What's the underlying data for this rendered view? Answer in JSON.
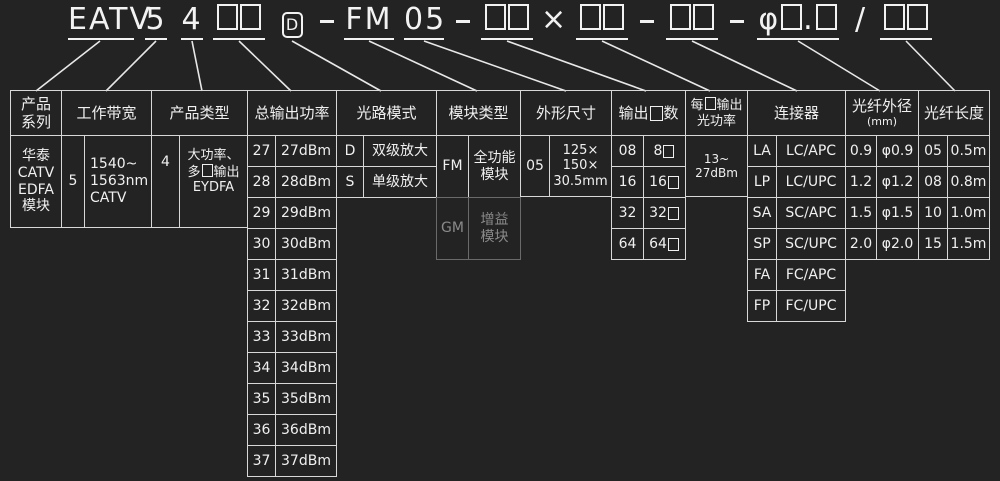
{
  "code": {
    "eatv": "EATV",
    "d5": "5",
    "d4": "4",
    "ptype": "D",
    "fm": "FM",
    "num05": "05",
    "times": "×",
    "phi": "φ",
    "dot": ".",
    "slash": "/"
  },
  "headers": {
    "series": "产品\n系列",
    "band": "工作带宽",
    "ptype": "产品类型",
    "power": "总输出功率",
    "route": "光路模式",
    "module": "模块类型",
    "size": "外形尺寸",
    "ports": "输出",
    "ports_suffix": "数",
    "perport": "每",
    "perport_suffix": "输出\n光功率",
    "connector": "连接器",
    "diameter": "光纤外径",
    "diameter_unit": "(mm)",
    "length": "光纤长度"
  },
  "series": {
    "text": "华泰\nCATV\nEDFA\n模块"
  },
  "band": {
    "code": "5",
    "text": "1540~\n1563nm\nCATV"
  },
  "ptype": {
    "code": "4",
    "text_a": "大功率、\n多",
    "text_b": "输出\nEYDFA"
  },
  "power": [
    {
      "code": "27",
      "val": "27dBm"
    },
    {
      "code": "28",
      "val": "28dBm"
    },
    {
      "code": "29",
      "val": "29dBm"
    },
    {
      "code": "30",
      "val": "30dBm"
    },
    {
      "code": "31",
      "val": "31dBm"
    },
    {
      "code": "32",
      "val": "32dBm"
    },
    {
      "code": "33",
      "val": "33dBm"
    },
    {
      "code": "34",
      "val": "34dBm"
    },
    {
      "code": "35",
      "val": "35dBm"
    },
    {
      "code": "36",
      "val": "36dBm"
    },
    {
      "code": "37",
      "val": "37dBm"
    }
  ],
  "route": [
    {
      "code": "D",
      "val": "双级放大"
    },
    {
      "code": "S",
      "val": "单级放大"
    }
  ],
  "module": [
    {
      "code": "FM",
      "val": "全功能\n模块"
    },
    {
      "code": "GM",
      "val": "增益\n模块"
    }
  ],
  "size": {
    "code": "05",
    "val": "125×\n150×\n30.5mm"
  },
  "ports": [
    {
      "code": "08",
      "val": "8"
    },
    {
      "code": "16",
      "val": "16"
    },
    {
      "code": "32",
      "val": "32"
    },
    {
      "code": "64",
      "val": "64"
    }
  ],
  "perport": {
    "val": "13~\n27dBm"
  },
  "connector": [
    {
      "code": "LA",
      "val": "LC/APC"
    },
    {
      "code": "LP",
      "val": "LC/UPC"
    },
    {
      "code": "SA",
      "val": "SC/APC"
    },
    {
      "code": "SP",
      "val": "SC/UPC"
    },
    {
      "code": "FA",
      "val": "FC/APC"
    },
    {
      "code": "FP",
      "val": "FC/UPC"
    }
  ],
  "diameter": [
    {
      "code": "0.9",
      "val": "0.9"
    },
    {
      "code": "1.2",
      "val": "1.2"
    },
    {
      "code": "1.5",
      "val": "1.5"
    },
    {
      "code": "2.0",
      "val": "2.0"
    }
  ],
  "length": [
    {
      "code": "05",
      "val": "0.5m"
    },
    {
      "code": "08",
      "val": "0.8m"
    },
    {
      "code": "10",
      "val": "1.0m"
    },
    {
      "code": "15",
      "val": "1.5m"
    }
  ],
  "colors": {
    "bg": "#232323",
    "fg": "#f0f0f0",
    "line": "#d8d8d8",
    "dim": "#8a8a8a"
  }
}
